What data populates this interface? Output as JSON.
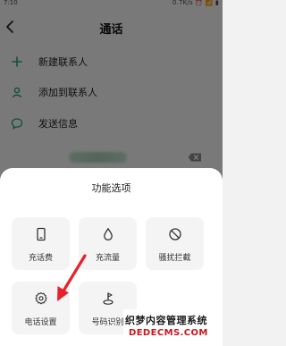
{
  "statusbar": {
    "time": "7:10",
    "right": "0.7K/s ⏰ 📶 ▮"
  },
  "header": {
    "title": "通话"
  },
  "menu": [
    {
      "label": "新建联系人",
      "icon": "plus-icon"
    },
    {
      "label": "添加到联系人",
      "icon": "person-icon"
    },
    {
      "label": "发送信息",
      "icon": "message-icon"
    }
  ],
  "sheet": {
    "title": "功能选项",
    "tiles": [
      {
        "label": "充话费",
        "icon": "phone-icon"
      },
      {
        "label": "充流量",
        "icon": "droplet-icon"
      },
      {
        "label": "骚扰拦截",
        "icon": "block-icon"
      },
      {
        "label": "电话设置",
        "icon": "gear-icon"
      },
      {
        "label": "号码识别",
        "icon": "location-pin-icon"
      }
    ]
  },
  "watermark": {
    "line1": "织梦内容管理系统",
    "line2": "DEDECMS.COM"
  },
  "colors": {
    "accent": "#1fa463",
    "arrow": "#e8202a"
  }
}
